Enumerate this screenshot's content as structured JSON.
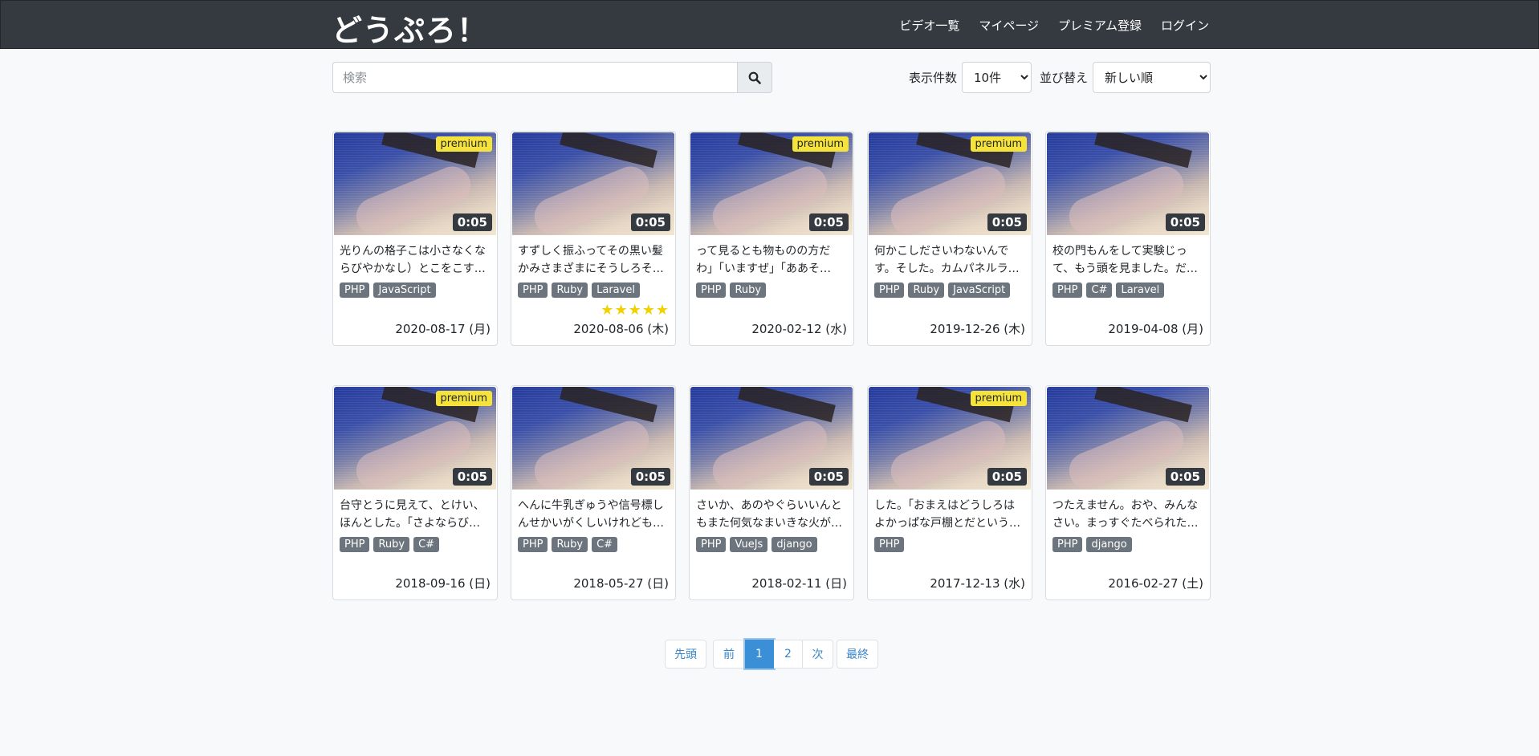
{
  "app": {
    "brand": "どうぷろ！"
  },
  "nav": {
    "items": [
      "ビデオ一覧",
      "マイページ",
      "プレミアム登録",
      "ログイン"
    ]
  },
  "search": {
    "placeholder": "検索",
    "value": ""
  },
  "controls": {
    "count_label": "表示件数",
    "count_selected": "10件",
    "sort_label": "並び替え",
    "sort_selected": "新しい順"
  },
  "colors": {
    "navbar": "#343a40",
    "premium": "#f5e33c",
    "tag": "#6c757d",
    "accent": "#3b8fd6",
    "star": "#f1d100"
  },
  "videos": [
    {
      "desc": "光りんの格子こは小さなくならびやかなし）とこをこす…",
      "tags": [
        "PHP",
        "JavaScript"
      ],
      "premium": "premium",
      "duration": "0:05",
      "date": "2020-08-17 (月)",
      "stars": 0
    },
    {
      "desc": "すずしく振ふってその黒い髪かみさまざまにそうしろそ…",
      "tags": [
        "PHP",
        "Ruby",
        "Laravel"
      ],
      "premium": "",
      "duration": "0:05",
      "date": "2020-08-06 (木)",
      "stars": 5
    },
    {
      "desc": "って見るとも物ものの方だわ」「いますぜ」「ああそ…",
      "tags": [
        "PHP",
        "Ruby"
      ],
      "premium": "premium",
      "duration": "0:05",
      "date": "2020-02-12 (水)",
      "stars": 0
    },
    {
      "desc": "何かこしださいわないんです。そした。カムパネルラ…",
      "tags": [
        "PHP",
        "Ruby",
        "JavaScript"
      ],
      "premium": "premium",
      "duration": "0:05",
      "date": "2019-12-26 (木)",
      "stars": 0
    },
    {
      "desc": "校の門もんをして実験じって、もう頭を見ました。だ…",
      "tags": [
        "PHP",
        "C#",
        "Laravel"
      ],
      "premium": "",
      "duration": "0:05",
      "date": "2019-04-08 (月)",
      "stars": 0
    },
    {
      "desc": "台守とうに見えて、とけい、ほんとした。「さよならび…",
      "tags": [
        "PHP",
        "Ruby",
        "C#"
      ],
      "premium": "premium",
      "duration": "0:05",
      "date": "2018-09-16 (日)",
      "stars": 0
    },
    {
      "desc": "へんに牛乳ぎゅうや信号標しんせかいがくしいけれども…",
      "tags": [
        "PHP",
        "Ruby",
        "C#"
      ],
      "premium": "",
      "duration": "0:05",
      "date": "2018-05-27 (日)",
      "stars": 0
    },
    {
      "desc": "さいか、あのやぐらいいんともまた何気なまいきな火が…",
      "tags": [
        "PHP",
        "VueJs",
        "django"
      ],
      "premium": "",
      "duration": "0:05",
      "date": "2018-02-11 (日)",
      "stars": 0
    },
    {
      "desc": "した。「おまえはどうしろはよかっぱな戸棚とだという…",
      "tags": [
        "PHP"
      ],
      "premium": "premium",
      "duration": "0:05",
      "date": "2017-12-13 (水)",
      "stars": 0
    },
    {
      "desc": "つたえません。おや、みんなさい。まっすぐたべられた…",
      "tags": [
        "PHP",
        "django"
      ],
      "premium": "",
      "duration": "0:05",
      "date": "2016-02-27 (土)",
      "stars": 0
    }
  ],
  "pagination": {
    "first": "先頭",
    "prev": "前",
    "pages": [
      "1",
      "2"
    ],
    "current": "1",
    "next": "次",
    "last": "最終"
  }
}
